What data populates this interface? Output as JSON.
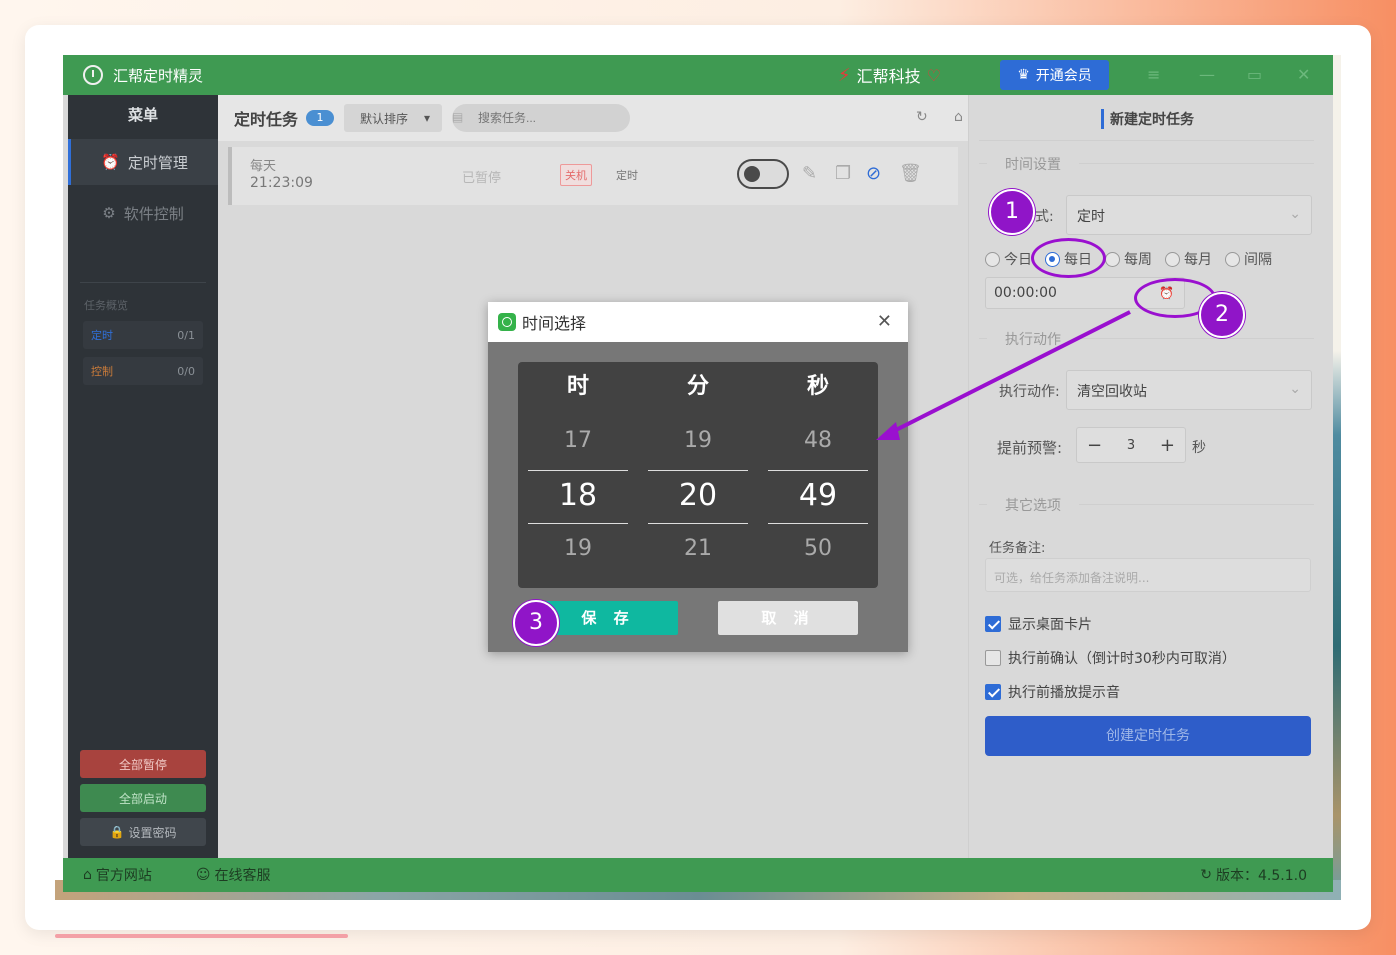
{
  "app": {
    "title": "汇帮定时精灵",
    "brand": "汇帮科技",
    "vip_button": "开通会员"
  },
  "sidebar": {
    "title": "菜单",
    "items": [
      {
        "label": "定时管理",
        "icon": "alarm-clock-icon",
        "active": true
      },
      {
        "label": "软件控制",
        "icon": "gear-icon",
        "active": false
      }
    ],
    "overview_label": "任务概览",
    "stats": [
      {
        "label": "定时",
        "value": "0/1"
      },
      {
        "label": "控制",
        "value": "0/0"
      }
    ],
    "pause_all": "全部暂停",
    "start_all": "全部启动",
    "set_password": "设置密码"
  },
  "main": {
    "title": "定时任务",
    "count": "1",
    "sort_label": "默认排序",
    "search_placeholder": "搜索任务...",
    "tasks": [
      {
        "repeat": "每天",
        "time": "21:23:09",
        "status": "已暂停",
        "action_tag": "关机",
        "type": "定时",
        "enabled": false
      }
    ]
  },
  "panel": {
    "title": "新建定时任务",
    "time_section": "时间设置",
    "mode_label": "式:",
    "mode_value": "定时",
    "radios": [
      "今日",
      "每日",
      "每周",
      "每月",
      "间隔"
    ],
    "radio_selected": "每日",
    "time_value": "00:00:00",
    "action_section": "执行动作",
    "action_label": "执行动作:",
    "action_value": "清空回收站",
    "warn_label": "提前预警:",
    "warn_value": "3",
    "warn_unit": "秒",
    "other_section": "其它选项",
    "memo_label": "任务备注:",
    "memo_placeholder": "可选，给任务添加备注说明...",
    "checks": [
      {
        "label": "显示桌面卡片",
        "checked": true
      },
      {
        "label": "执行前确认（倒计时30秒内可取消）",
        "checked": false
      },
      {
        "label": "执行前播放提示音",
        "checked": true
      }
    ],
    "create_button": "创建定时任务"
  },
  "footer": {
    "website": "官方网站",
    "support": "在线客服",
    "version": "版本：4.5.1.0"
  },
  "dialog": {
    "title": "时间选择",
    "columns": [
      {
        "header": "时",
        "prev": "17",
        "current": "18",
        "next": "19"
      },
      {
        "header": "分",
        "prev": "19",
        "current": "20",
        "next": "21"
      },
      {
        "header": "秒",
        "prev": "48",
        "current": "49",
        "next": "50"
      }
    ],
    "save": "保 存",
    "cancel": "取 消"
  },
  "annotations": {
    "step1": "1",
    "step2": "2",
    "step3": "3",
    "color": "#9a10cf"
  }
}
